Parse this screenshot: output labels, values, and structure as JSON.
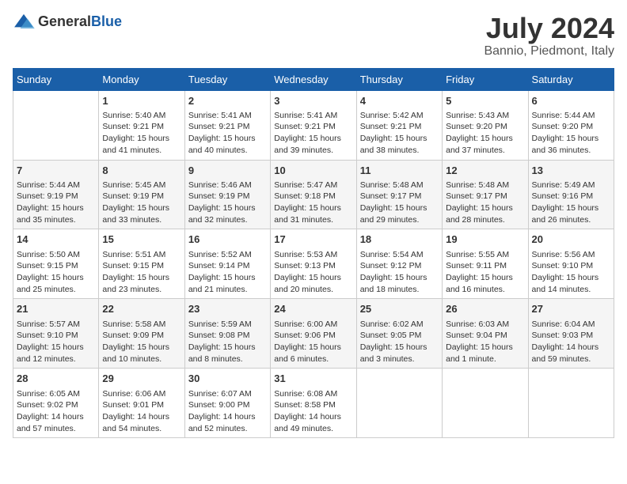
{
  "logo": {
    "general": "General",
    "blue": "Blue"
  },
  "title": "July 2024",
  "subtitle": "Bannio, Piedmont, Italy",
  "days_header": [
    "Sunday",
    "Monday",
    "Tuesday",
    "Wednesday",
    "Thursday",
    "Friday",
    "Saturday"
  ],
  "weeks": [
    [
      {
        "day": "",
        "info": ""
      },
      {
        "day": "1",
        "info": "Sunrise: 5:40 AM\nSunset: 9:21 PM\nDaylight: 15 hours\nand 41 minutes."
      },
      {
        "day": "2",
        "info": "Sunrise: 5:41 AM\nSunset: 9:21 PM\nDaylight: 15 hours\nand 40 minutes."
      },
      {
        "day": "3",
        "info": "Sunrise: 5:41 AM\nSunset: 9:21 PM\nDaylight: 15 hours\nand 39 minutes."
      },
      {
        "day": "4",
        "info": "Sunrise: 5:42 AM\nSunset: 9:21 PM\nDaylight: 15 hours\nand 38 minutes."
      },
      {
        "day": "5",
        "info": "Sunrise: 5:43 AM\nSunset: 9:20 PM\nDaylight: 15 hours\nand 37 minutes."
      },
      {
        "day": "6",
        "info": "Sunrise: 5:44 AM\nSunset: 9:20 PM\nDaylight: 15 hours\nand 36 minutes."
      }
    ],
    [
      {
        "day": "7",
        "info": "Sunrise: 5:44 AM\nSunset: 9:19 PM\nDaylight: 15 hours\nand 35 minutes."
      },
      {
        "day": "8",
        "info": "Sunrise: 5:45 AM\nSunset: 9:19 PM\nDaylight: 15 hours\nand 33 minutes."
      },
      {
        "day": "9",
        "info": "Sunrise: 5:46 AM\nSunset: 9:19 PM\nDaylight: 15 hours\nand 32 minutes."
      },
      {
        "day": "10",
        "info": "Sunrise: 5:47 AM\nSunset: 9:18 PM\nDaylight: 15 hours\nand 31 minutes."
      },
      {
        "day": "11",
        "info": "Sunrise: 5:48 AM\nSunset: 9:17 PM\nDaylight: 15 hours\nand 29 minutes."
      },
      {
        "day": "12",
        "info": "Sunrise: 5:48 AM\nSunset: 9:17 PM\nDaylight: 15 hours\nand 28 minutes."
      },
      {
        "day": "13",
        "info": "Sunrise: 5:49 AM\nSunset: 9:16 PM\nDaylight: 15 hours\nand 26 minutes."
      }
    ],
    [
      {
        "day": "14",
        "info": "Sunrise: 5:50 AM\nSunset: 9:15 PM\nDaylight: 15 hours\nand 25 minutes."
      },
      {
        "day": "15",
        "info": "Sunrise: 5:51 AM\nSunset: 9:15 PM\nDaylight: 15 hours\nand 23 minutes."
      },
      {
        "day": "16",
        "info": "Sunrise: 5:52 AM\nSunset: 9:14 PM\nDaylight: 15 hours\nand 21 minutes."
      },
      {
        "day": "17",
        "info": "Sunrise: 5:53 AM\nSunset: 9:13 PM\nDaylight: 15 hours\nand 20 minutes."
      },
      {
        "day": "18",
        "info": "Sunrise: 5:54 AM\nSunset: 9:12 PM\nDaylight: 15 hours\nand 18 minutes."
      },
      {
        "day": "19",
        "info": "Sunrise: 5:55 AM\nSunset: 9:11 PM\nDaylight: 15 hours\nand 16 minutes."
      },
      {
        "day": "20",
        "info": "Sunrise: 5:56 AM\nSunset: 9:10 PM\nDaylight: 15 hours\nand 14 minutes."
      }
    ],
    [
      {
        "day": "21",
        "info": "Sunrise: 5:57 AM\nSunset: 9:10 PM\nDaylight: 15 hours\nand 12 minutes."
      },
      {
        "day": "22",
        "info": "Sunrise: 5:58 AM\nSunset: 9:09 PM\nDaylight: 15 hours\nand 10 minutes."
      },
      {
        "day": "23",
        "info": "Sunrise: 5:59 AM\nSunset: 9:08 PM\nDaylight: 15 hours\nand 8 minutes."
      },
      {
        "day": "24",
        "info": "Sunrise: 6:00 AM\nSunset: 9:06 PM\nDaylight: 15 hours\nand 6 minutes."
      },
      {
        "day": "25",
        "info": "Sunrise: 6:02 AM\nSunset: 9:05 PM\nDaylight: 15 hours\nand 3 minutes."
      },
      {
        "day": "26",
        "info": "Sunrise: 6:03 AM\nSunset: 9:04 PM\nDaylight: 15 hours\nand 1 minute."
      },
      {
        "day": "27",
        "info": "Sunrise: 6:04 AM\nSunset: 9:03 PM\nDaylight: 14 hours\nand 59 minutes."
      }
    ],
    [
      {
        "day": "28",
        "info": "Sunrise: 6:05 AM\nSunset: 9:02 PM\nDaylight: 14 hours\nand 57 minutes."
      },
      {
        "day": "29",
        "info": "Sunrise: 6:06 AM\nSunset: 9:01 PM\nDaylight: 14 hours\nand 54 minutes."
      },
      {
        "day": "30",
        "info": "Sunrise: 6:07 AM\nSunset: 9:00 PM\nDaylight: 14 hours\nand 52 minutes."
      },
      {
        "day": "31",
        "info": "Sunrise: 6:08 AM\nSunset: 8:58 PM\nDaylight: 14 hours\nand 49 minutes."
      },
      {
        "day": "",
        "info": ""
      },
      {
        "day": "",
        "info": ""
      },
      {
        "day": "",
        "info": ""
      }
    ]
  ]
}
